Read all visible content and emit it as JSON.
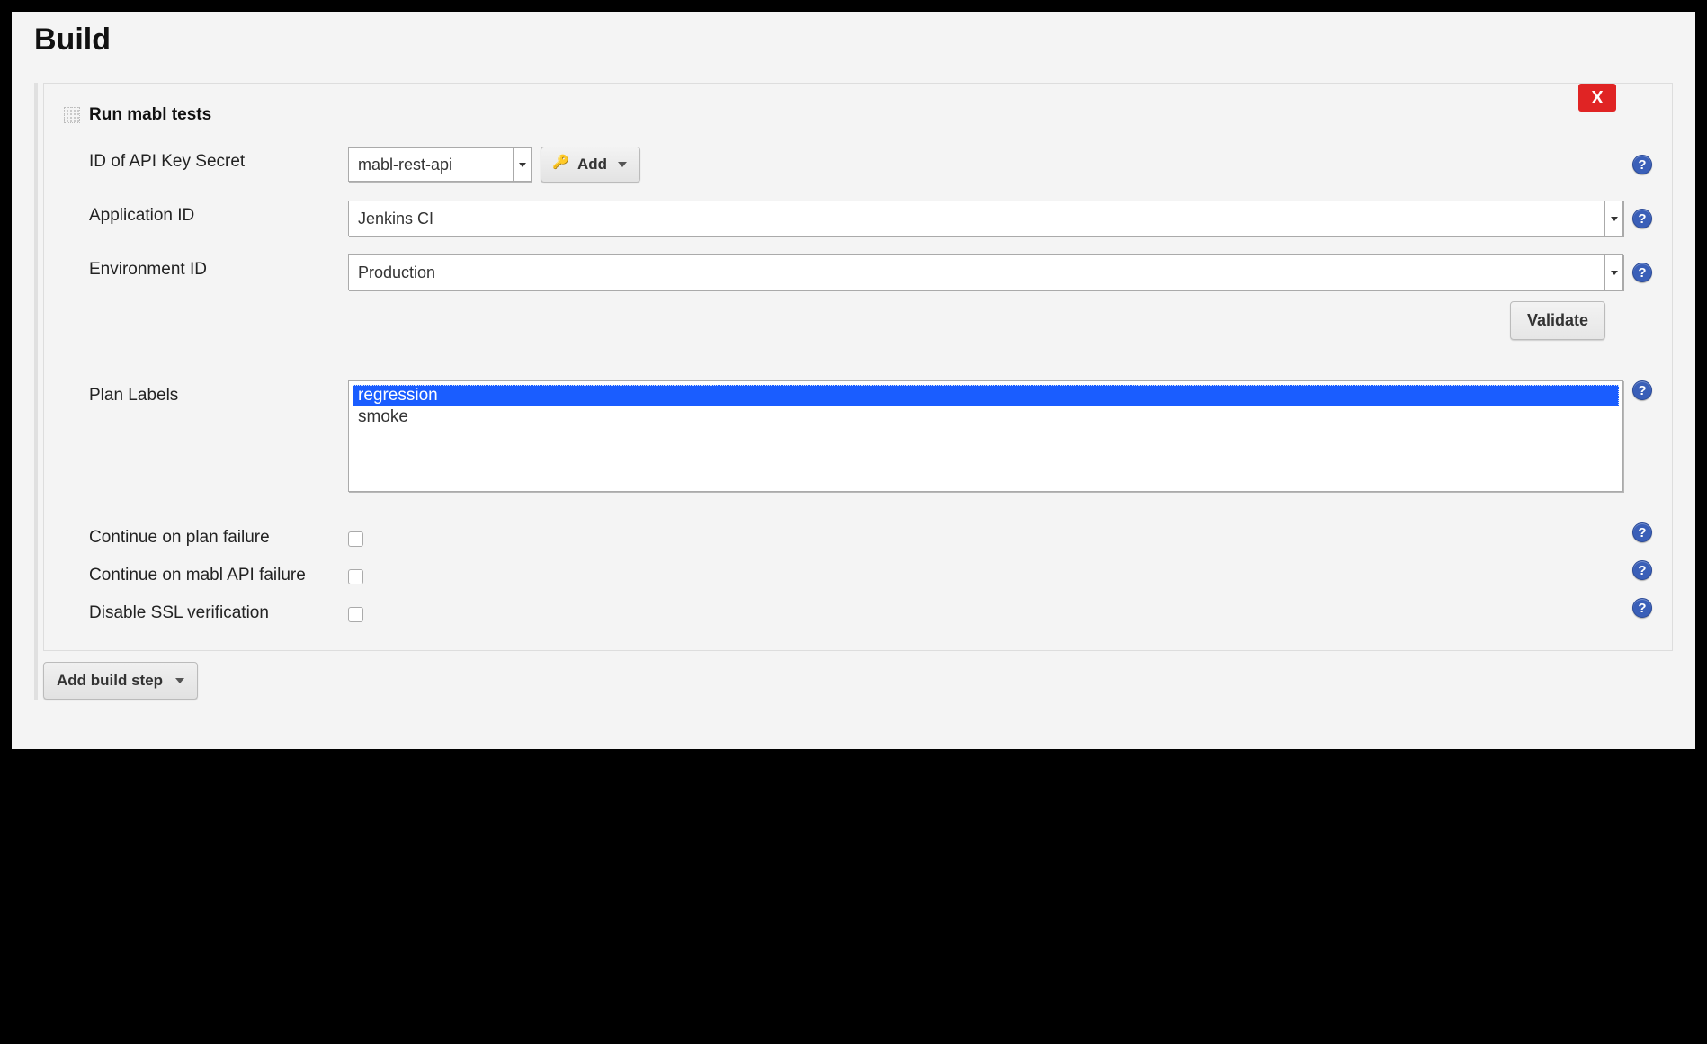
{
  "section": {
    "title": "Build"
  },
  "step": {
    "title": "Run mabl tests",
    "close_label": "X"
  },
  "fields": {
    "api_key": {
      "label": "ID of API Key Secret",
      "value": "mabl-rest-api",
      "add_label": "Add"
    },
    "application_id": {
      "label": "Application ID",
      "value": "Jenkins CI"
    },
    "environment_id": {
      "label": "Environment ID",
      "value": "Production"
    },
    "validate_label": "Validate",
    "plan_labels": {
      "label": "Plan Labels",
      "options": [
        "regression",
        "smoke"
      ],
      "selected": "regression"
    },
    "continue_plan_failure": {
      "label": "Continue on plan failure",
      "checked": false
    },
    "continue_api_failure": {
      "label": "Continue on mabl API failure",
      "checked": false
    },
    "disable_ssl": {
      "label": "Disable SSL verification",
      "checked": false
    }
  },
  "footer": {
    "add_step_label": "Add build step"
  }
}
